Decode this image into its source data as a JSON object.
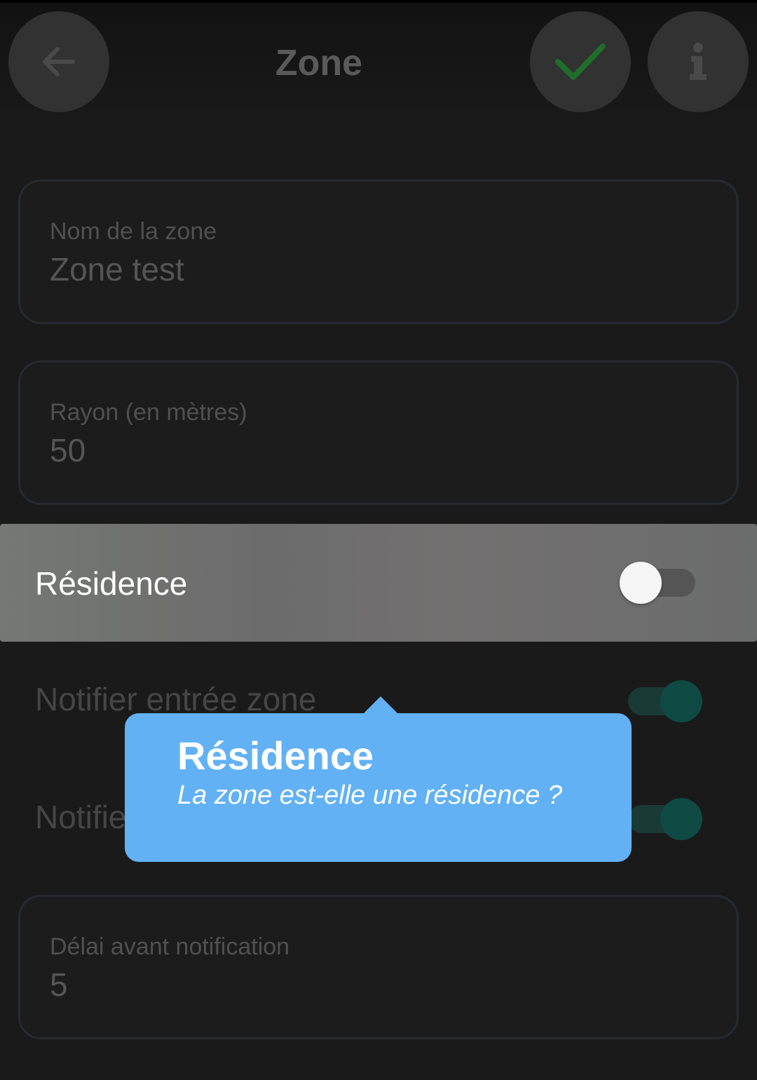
{
  "header": {
    "title": "Zone",
    "back_icon": "arrow-left-icon",
    "confirm_icon": "check-icon",
    "info_icon": "info-icon"
  },
  "fields": {
    "zone_name": {
      "label": "Nom de la zone",
      "value": "Zone test"
    },
    "radius": {
      "label": "Rayon (en mètres)",
      "value": "50"
    },
    "delay": {
      "label": "Délai avant notification",
      "value": "5"
    }
  },
  "residence": {
    "label": "Résidence",
    "toggle_on": false
  },
  "notify_entry": {
    "label": "Notifier entrée zone",
    "toggle_on": true
  },
  "notify_exit": {
    "label": "Notifie",
    "toggle_on": true
  },
  "tooltip": {
    "title": "Résidence",
    "subtitle": "La zone est-elle une résidence ?"
  },
  "colors": {
    "tooltip_bg": "#62b1f4",
    "check_green": "#1f6f2a",
    "toggle_on_dim": "#0f4a44"
  }
}
